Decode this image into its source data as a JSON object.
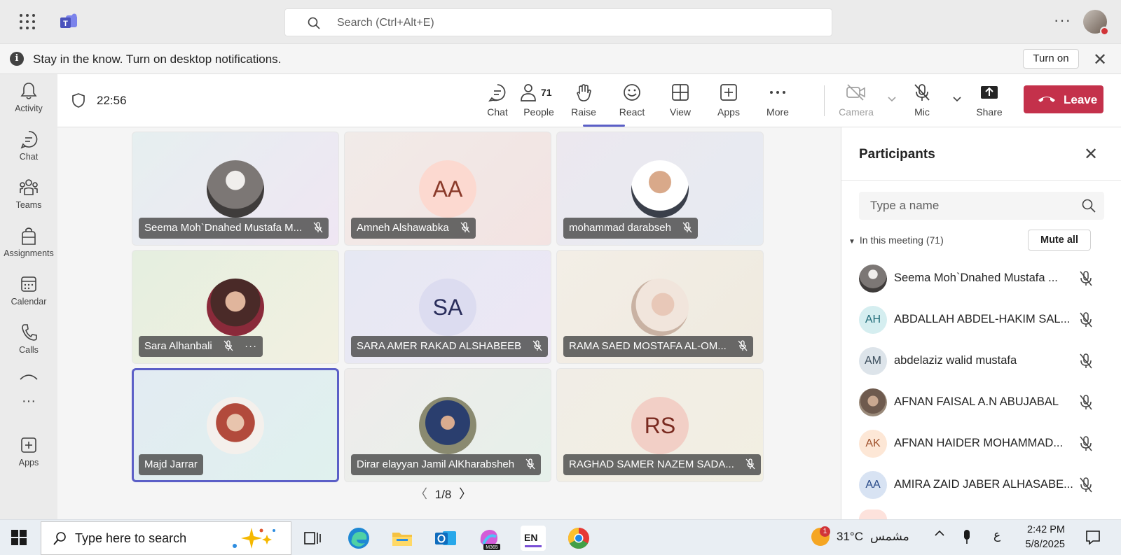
{
  "topbar": {
    "search_placeholder": "Search (Ctrl+Alt+E)",
    "more_label": "···"
  },
  "notification": {
    "info": "i",
    "message": "Stay in the know. Turn on desktop notifications.",
    "turn_on_label": "Turn on",
    "close": "✕"
  },
  "rail": [
    {
      "label": "Activity",
      "icon": "bell-icon"
    },
    {
      "label": "Chat",
      "icon": "chat-icon"
    },
    {
      "label": "Teams",
      "icon": "teams-icon"
    },
    {
      "label": "Assignments",
      "icon": "assignments-icon"
    },
    {
      "label": "Calendar",
      "icon": "calendar-icon"
    },
    {
      "label": "Calls",
      "icon": "phone-icon"
    },
    {
      "label": "Apps",
      "icon": "apps-icon"
    }
  ],
  "meeting": {
    "timer": "22:56",
    "people_count": "71",
    "toolbar": {
      "chat": "Chat",
      "people": "People",
      "raise": "Raise",
      "react": "React",
      "view": "View",
      "apps": "Apps",
      "more": "More",
      "camera": "Camera",
      "mic": "Mic",
      "share": "Share",
      "leave": "Leave"
    }
  },
  "tiles": [
    {
      "name": "Seema Moh`Dnahed Mustafa M...",
      "initials": "",
      "muted": true
    },
    {
      "name": "Amneh Alshawabka",
      "initials": "AA",
      "muted": true
    },
    {
      "name": "mohammad darabseh",
      "initials": "",
      "muted": true
    },
    {
      "name": "Sara Alhanbali",
      "initials": "",
      "muted": true,
      "more": "···"
    },
    {
      "name": "SARA AMER RAKAD ALSHABEEB",
      "initials": "SA",
      "muted": true
    },
    {
      "name": "RAMA SAED MOSTAFA AL-OM...",
      "initials": "",
      "muted": true
    },
    {
      "name": "Majd Jarrar",
      "initials": "",
      "muted": false
    },
    {
      "name": "Dirar elayyan Jamil AlKharabsheh",
      "initials": "",
      "muted": true
    },
    {
      "name": "RAGHAD SAMER NAZEM SADA...",
      "initials": "RS",
      "muted": true
    }
  ],
  "pager": {
    "prev": "〈",
    "page": "1/8",
    "next": "〉"
  },
  "participants": {
    "title": "Participants",
    "close": "✕",
    "search_placeholder": "Type a name",
    "section_label": "In this meeting (71)",
    "mute_all": "Mute all",
    "list": [
      {
        "name": "Seema Moh`Dnahed Mustafa ...",
        "initials": ""
      },
      {
        "name": "ABDALLAH ABDEL-HAKIM SAL...",
        "initials": "AH"
      },
      {
        "name": "abdelaziz walid mustafa",
        "initials": "AM"
      },
      {
        "name": "AFNAN FAISAL A.N ABUJABAL",
        "initials": ""
      },
      {
        "name": "AFNAN HAIDER MOHAMMAD...",
        "initials": "AK"
      },
      {
        "name": "AMIRA ZAID JABER ALHASABE...",
        "initials": "AA"
      }
    ]
  },
  "taskbar": {
    "search_placeholder": "Type here to search",
    "weather_badge": "1",
    "temperature": "31°C",
    "weather_desc": "مشمس",
    "language": "ع",
    "time": "2:42 PM",
    "date": "5/8/2025",
    "app_lang_icon": "EN",
    "m365_label": "M365"
  },
  "colors": {
    "accent": "#5b5fc7",
    "leave": "#c4314b"
  }
}
